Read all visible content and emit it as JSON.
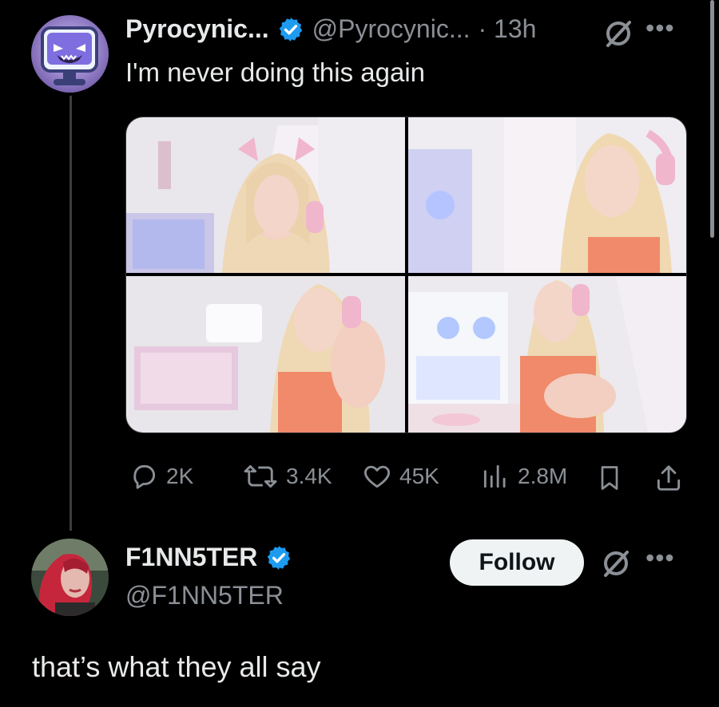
{
  "tweet": {
    "author_name": "Pyrocynic...",
    "author_handle": "@Pyrocynic...",
    "time": "· 13h",
    "text": "I'm never doing this again",
    "avatar_icon": "pink-monitor-ghost-avatar",
    "media_count": 4,
    "actions": {
      "replies": "2K",
      "reposts": "3.4K",
      "likes": "45K",
      "views": "2.8M"
    }
  },
  "reply": {
    "author_name": "F1NN5TER",
    "author_handle": "@F1NN5TER",
    "follow_label": "Follow",
    "text": "that’s what they all say"
  },
  "colors": {
    "background": "#000000",
    "text_primary": "#e7e9ea",
    "text_secondary": "#8b9096",
    "verified_blue": "#1d9bf0",
    "follow_bg": "#eff3f4"
  }
}
